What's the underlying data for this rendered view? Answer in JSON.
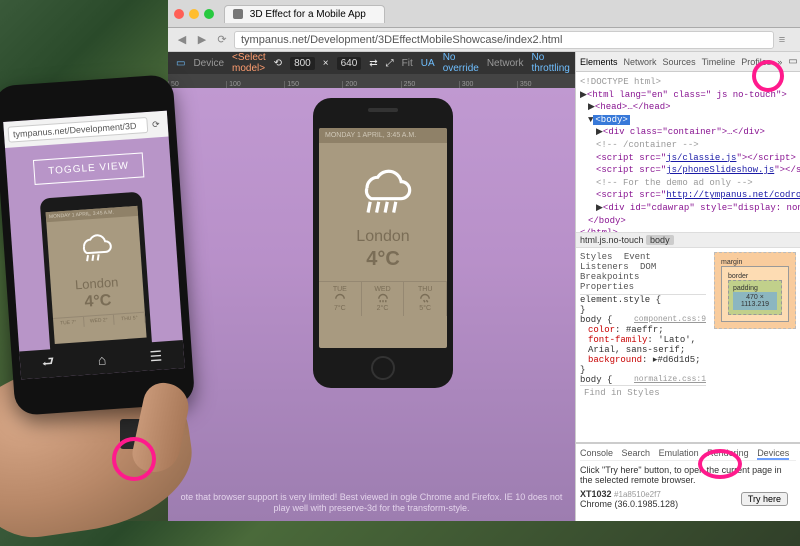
{
  "browser": {
    "tab_title": "3D Effect for a Mobile App",
    "url": "tympanus.net/Development/3DEffectMobileShowcase/index2.html"
  },
  "device_bar": {
    "label_device": "Device",
    "model": "<Select model>",
    "width": "800",
    "height": "640",
    "label_network": "Network",
    "throttle": "No throttling",
    "fit_icon_tip": "Fit",
    "ua_label": "UA",
    "ua_value": "No override"
  },
  "demo": {
    "weather": {
      "header_date": "MONDAY 1 APRIL, 3:45 A.M.",
      "city": "London",
      "temp": "4°C",
      "forecast": [
        {
          "day": "TUE",
          "t": "7°C"
        },
        {
          "day": "WED",
          "t": "2°C"
        },
        {
          "day": "THU",
          "t": "5°C"
        }
      ]
    },
    "footer_note": "ote that browser support is very limited! Best viewed in ogle Chrome and Firefox. IE 10 does not play well with preserve-3d for the transform-style."
  },
  "phys_phone": {
    "addr": "tympanus.net/Development/3D",
    "toggle": "TOGGLE VIEW",
    "weather": {
      "header_date": "MONDAY 1 APRIL, 3:45 A.M.",
      "city": "London",
      "temp": "4°C",
      "forecast": [
        {
          "day": "TUE",
          "t": "7°"
        },
        {
          "day": "WED",
          "t": "2°"
        },
        {
          "day": "THU",
          "t": "5°"
        }
      ]
    }
  },
  "devtools": {
    "tabs": [
      "Elements",
      "Network",
      "Sources",
      "Timeline",
      "Profiles"
    ],
    "dom": {
      "doctype": "<!DOCTYPE html>",
      "html_open": "<html lang=\"en\" class=\" js no-touch\">",
      "head": "<head>…</head>",
      "body_open": "<body>",
      "container": "<div class=\"container\">…</div>",
      "comment": "<!-- /container -->",
      "script1": "js/classie.js",
      "script2": "js/phoneSlideshow.js",
      "comment2": "<!-- For the demo ad only -->",
      "script3": "http://tympanus.net/codrops/adpacks/demoad.js",
      "cdawrap": "<div id=\"cdawrap\" style=\"display: none;\">…</div>",
      "body_close": "</body>",
      "html_close": "</html>"
    },
    "breadcrumb": {
      "root": "html.js.no-touch",
      "curr": "body"
    },
    "styles": {
      "tabs": [
        "Styles",
        "Event Listeners",
        "DOM Breakpoints",
        "Properties"
      ],
      "elem_style": "element.style {",
      "rule_src1": "component.css:9",
      "body_open": "body {",
      "p_color_n": "color",
      "p_color_v": "#aeffr;",
      "p_font_n": "font-family",
      "p_font_v": "'Lato', Arial, sans-serif;",
      "p_bg_n": "background",
      "p_bg_v": "#d6d1d5;",
      "rule_src2": "normalize.css:1",
      "find": "Find in Styles"
    },
    "box": {
      "margin": "margin",
      "border": "border",
      "padding": "padding",
      "content": "470 × 1113.219"
    },
    "console": {
      "tabs": [
        "Console",
        "Search",
        "Emulation",
        "Rendering",
        "Devices"
      ],
      "hint": "Click \"Try here\" button, to open the current page in the selected remote browser.",
      "device_id": "XT1032",
      "device_hash": "#1a8510e2f7",
      "chrome_ver": "Chrome (36.0.1985.128)",
      "try_btn": "Try here"
    }
  }
}
